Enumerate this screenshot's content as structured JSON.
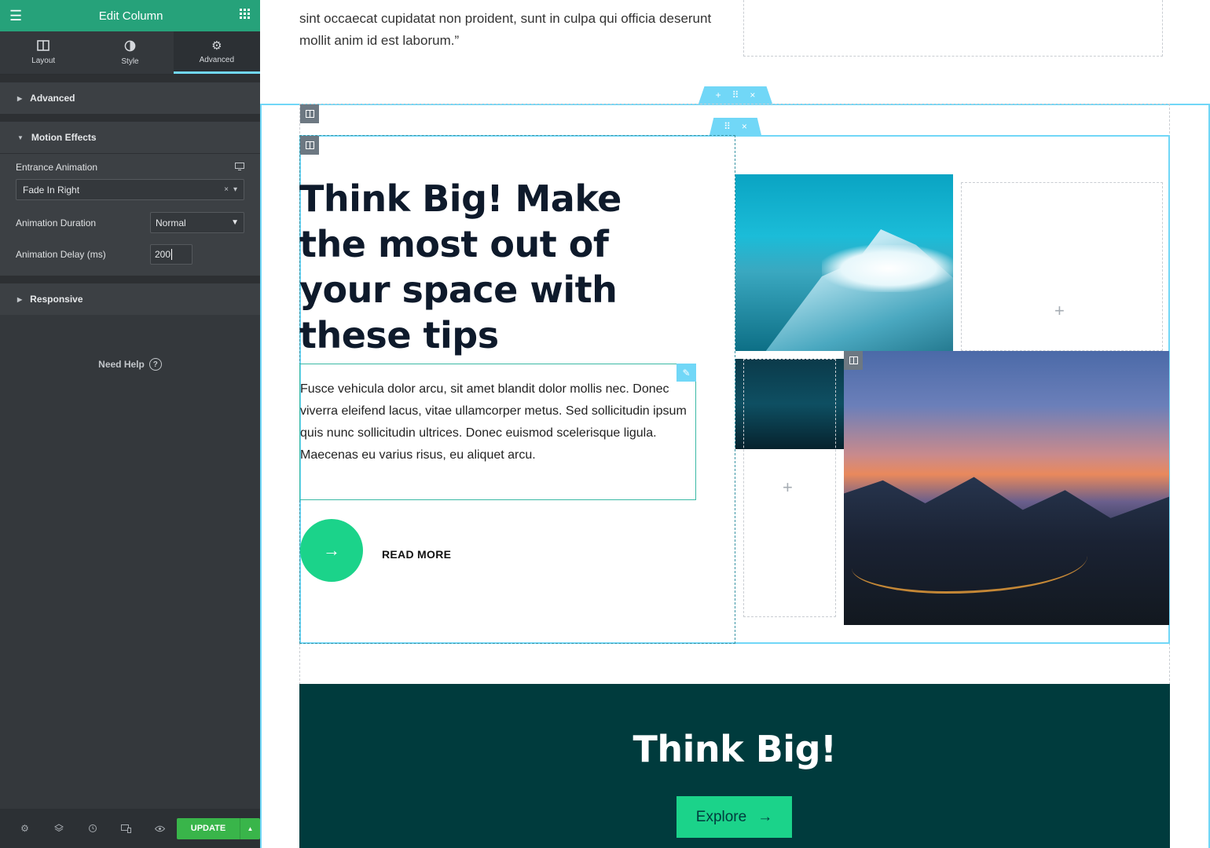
{
  "sidebar": {
    "header_title": "Edit Column",
    "tabs": [
      {
        "label": "Layout",
        "icon": "columns-icon"
      },
      {
        "label": "Style",
        "icon": "half-circle-icon"
      },
      {
        "label": "Advanced",
        "icon": "gear-icon"
      }
    ],
    "sections": {
      "advanced": "Advanced",
      "motion": "Motion Effects",
      "responsive": "Responsive"
    },
    "motion": {
      "entrance_label": "Entrance Animation",
      "entrance_value": "Fade In Right",
      "duration_label": "Animation Duration",
      "duration_value": "Normal",
      "delay_label": "Animation Delay (ms)",
      "delay_value": "200"
    },
    "need_help": "Need Help",
    "update_label": "UPDATE"
  },
  "canvas": {
    "quote": "sint occaecat cupidatat non proident, sunt in culpa qui officia deserunt mollit anim id est laborum.”",
    "heading": "Think Big! Make the most out of your space with these tips",
    "paragraph": "Fusce vehicula dolor arcu, sit amet blandit dolor mollis nec. Donec viverra eleifend lacus, vitae ullamcorper metus. Sed sollicitudin ipsum quis nunc sollicitudin ultrices. Donec euismod scelerisque ligula. Maecenas eu varius risus, eu aliquet arcu.",
    "read_more": "READ MORE",
    "band_title": "Think Big!",
    "explore_label": "Explore"
  },
  "colors": {
    "header_green": "#26a27a",
    "accent_cyan": "#71d7f7",
    "cta_green": "#1bd38a",
    "dark_teal": "#003b3d",
    "update_green": "#39b54a"
  }
}
